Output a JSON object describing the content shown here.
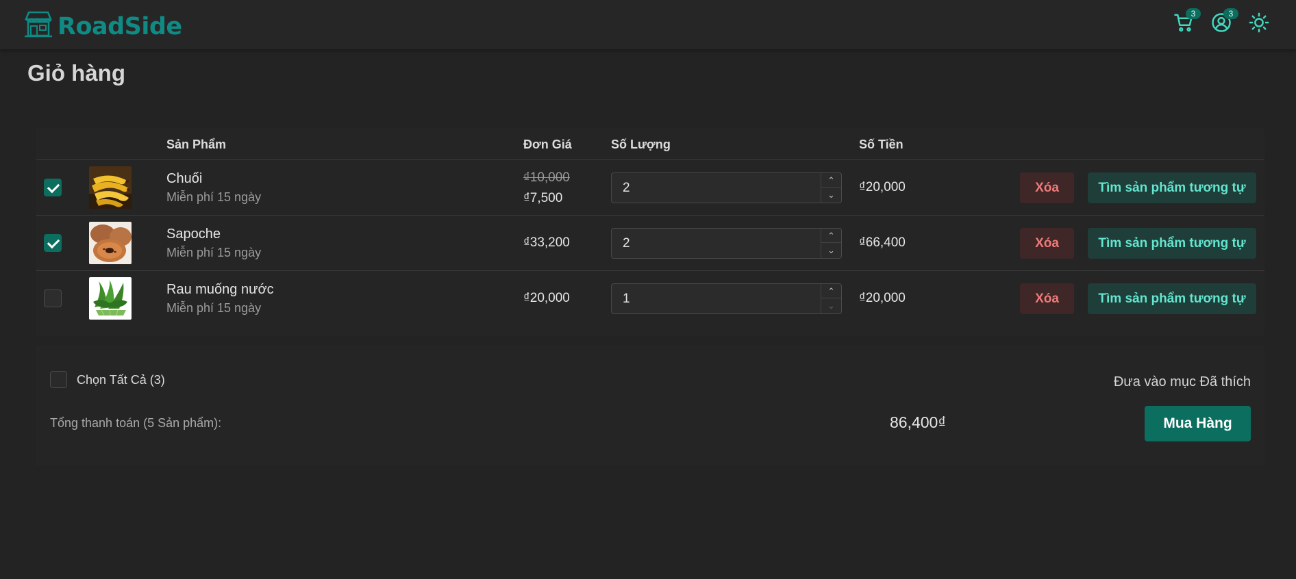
{
  "header": {
    "brand": "RoadSide",
    "cart_badge": "3",
    "account_badge": "3"
  },
  "page": {
    "title": "Giỏ hàng"
  },
  "table": {
    "columns": {
      "product": "Sản Phẩm",
      "unit_price": "Đơn Giá",
      "quantity": "Số Lượng",
      "amount": "Số Tiền"
    },
    "rows": [
      {
        "name": "Chuối",
        "note": "Miễn phí 15 ngày",
        "old_price": "₫10,000",
        "price": "₫7,500",
        "quantity": "2",
        "amount": "₫20,000",
        "checked": true,
        "delete_label": "Xóa",
        "similar_label": "Tìm sản phẩm tương tự"
      },
      {
        "name": "Sapoche",
        "note": "Miễn phí 15 ngày",
        "price": "₫33,200",
        "quantity": "2",
        "amount": "₫66,400",
        "checked": true,
        "delete_label": "Xóa",
        "similar_label": "Tìm sản phẩm tương tự"
      },
      {
        "name": "Rau muống nước",
        "note": "Miễn phí 15 ngày",
        "price": "₫20,000",
        "quantity": "1",
        "amount": "₫20,000",
        "checked": false,
        "delete_label": "Xóa",
        "similar_label": "Tìm sản phẩm tương tự"
      }
    ]
  },
  "footer": {
    "select_all": "Chọn Tất Cả (3)",
    "favorite": "Đưa vào mục Đã thích",
    "total_label": "Tổng thanh toán (5 Sản phẩm):",
    "total_value": "86,400₫",
    "buy_label": "Mua Hàng"
  },
  "colors": {
    "accent": "#0c6e5e",
    "brand": "#0f8a84",
    "danger": "#f07a7a",
    "teal_text": "#62e6cf"
  },
  "icons": [
    "store-icon",
    "cart-icon",
    "user-icon",
    "sun-icon",
    "check-icon",
    "chevron-up-icon",
    "chevron-down-icon"
  ]
}
